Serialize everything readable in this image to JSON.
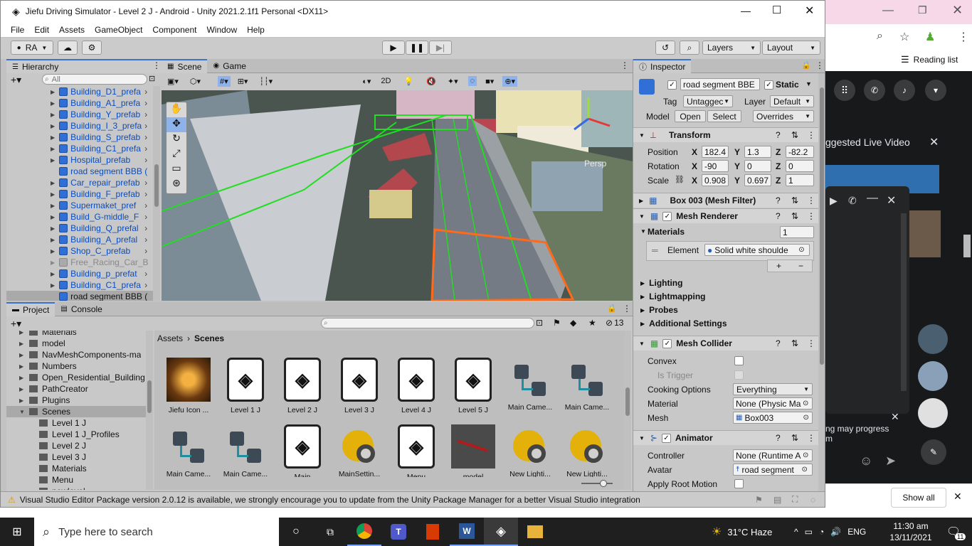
{
  "window": {
    "title": "Jiefu Driving Simulator - Level 2 J - Android - Unity 2021.2.1f1 Personal <DX11>"
  },
  "menu": [
    "File",
    "Edit",
    "Assets",
    "GameObject",
    "Component",
    "Window",
    "Help"
  ],
  "toolbar": {
    "account": "RA",
    "layers_label": "Layers",
    "layout_label": "Layout"
  },
  "hierarchy": {
    "tab": "Hierarchy",
    "search_placeholder": "All",
    "items": [
      {
        "label": "Building_D1_prefa"
      },
      {
        "label": "Building_A1_prefa"
      },
      {
        "label": "Building_Y_prefab"
      },
      {
        "label": "Building_I_3_prefa"
      },
      {
        "label": "Building_S_prefab"
      },
      {
        "label": "Building_C1_prefa"
      },
      {
        "label": "Hospital_prefab"
      },
      {
        "label": "road segment BBB ("
      },
      {
        "label": "Car_repair_prefab"
      },
      {
        "label": "Building_F_prefab"
      },
      {
        "label": "Supermaket_pref"
      },
      {
        "label": "Build_G-middle_F"
      },
      {
        "label": "Building_Q_prefal"
      },
      {
        "label": "Building_A_prefal"
      },
      {
        "label": "Shop_C_prefab"
      },
      {
        "label": "Free_Racing_Car_Bl"
      },
      {
        "label": "Building_p_prefat"
      },
      {
        "label": "Building_C1_prefa"
      },
      {
        "label": "road segment BBB ("
      }
    ]
  },
  "scene": {
    "tab_scene": "Scene",
    "tab_game": "Game",
    "mode_2d": "2D",
    "persp_label": "Persp"
  },
  "project": {
    "tab_project": "Project",
    "tab_console": "Console",
    "hidden_count": "13",
    "breadcrumb": [
      "Assets",
      "Scenes"
    ],
    "tree": [
      {
        "label": "Materials",
        "indent": 0
      },
      {
        "label": "model",
        "indent": 0
      },
      {
        "label": "NavMeshComponents-ma",
        "indent": 0
      },
      {
        "label": "Numbers",
        "indent": 0
      },
      {
        "label": "Open_Residential_Building",
        "indent": 0
      },
      {
        "label": "PathCreator",
        "indent": 0
      },
      {
        "label": "Plugins",
        "indent": 0
      },
      {
        "label": "Scenes",
        "indent": 0
      },
      {
        "label": "Level 1 J",
        "indent": 1
      },
      {
        "label": "Level 1 J_Profiles",
        "indent": 1
      },
      {
        "label": "Level 2 J",
        "indent": 1
      },
      {
        "label": "Level 3 J",
        "indent": 1
      },
      {
        "label": "Materials",
        "indent": 1
      },
      {
        "label": "Menu",
        "indent": 1
      },
      {
        "label": "newlevel",
        "indent": 1
      }
    ],
    "assets_row1": [
      {
        "label": "Jiefu Icon ...",
        "kind": "image"
      },
      {
        "label": "Level 1 J",
        "kind": "unity"
      },
      {
        "label": "Level 2 J",
        "kind": "unity"
      },
      {
        "label": "Level 3 J",
        "kind": "unity"
      },
      {
        "label": "Level 4 J",
        "kind": "unity"
      },
      {
        "label": "Level 5 J",
        "kind": "unity"
      },
      {
        "label": "Main Came...",
        "kind": "prefab"
      },
      {
        "label": "Main Came...",
        "kind": "prefab"
      }
    ],
    "assets_row2": [
      {
        "label": "Main Came...",
        "kind": "prefab"
      },
      {
        "label": "Main Came...",
        "kind": "prefab"
      },
      {
        "label": "Main",
        "kind": "unity"
      },
      {
        "label": "MainSettin...",
        "kind": "light"
      },
      {
        "label": "Menu",
        "kind": "unity"
      },
      {
        "label": "model",
        "kind": "model"
      },
      {
        "label": "New Lighti...",
        "kind": "light"
      },
      {
        "label": "New Lighti...",
        "kind": "light"
      }
    ]
  },
  "inspector": {
    "tab": "Inspector",
    "object_name": "road segment BBE",
    "static_label": "Static",
    "tag_label": "Tag",
    "tag_value": "Untaggec",
    "layer_label": "Layer",
    "layer_value": "Default",
    "model_label": "Model",
    "open_label": "Open",
    "select_label": "Select",
    "overrides_label": "Overrides",
    "transform": {
      "title": "Transform",
      "position_label": "Position",
      "rotation_label": "Rotation",
      "scale_label": "Scale",
      "position": {
        "x": "182.4",
        "y": "1.3",
        "z": "-82.2"
      },
      "rotation": {
        "x": "-90",
        "y": "0",
        "z": "0"
      },
      "scale": {
        "x": "0.908",
        "y": "0.697",
        "z": "1"
      }
    },
    "mesh_filter": "Box 003 (Mesh Filter)",
    "mesh_renderer": "Mesh Renderer",
    "materials_label": "Materials",
    "materials_count": "1",
    "element_label": "Element",
    "element_value": "Solid white shoulde",
    "foldouts": [
      "Lighting",
      "Lightmapping",
      "Probes",
      "Additional Settings"
    ],
    "mesh_collider": {
      "title": "Mesh Collider",
      "convex": "Convex",
      "is_trigger": "Is Trigger",
      "cooking_label": "Cooking Options",
      "cooking_value": "Everything",
      "material_label": "Material",
      "material_value": "None (Physic Ma",
      "mesh_label": "Mesh",
      "mesh_value": "Box003"
    },
    "animator": {
      "title": "Animator",
      "controller_label": "Controller",
      "controller_value": "None (Runtime A",
      "avatar_label": "Avatar",
      "avatar_value": "road segment",
      "apply_root_label": "Apply Root Motion"
    }
  },
  "statusbar": "Visual Studio Editor Package version 2.0.12 is available, we strongly encourage you to update from the Unity Package Manager for a better Visual Studio integration",
  "browser": {
    "reading_list": "Reading list",
    "suggested": "ggested Live Video",
    "progress_text": "ng may progress",
    "progress_text2": "m",
    "show_all": "Show all"
  },
  "taskbar": {
    "search_placeholder": "Type here to search",
    "weather": "31°C  Haze",
    "lang": "ENG",
    "time": "11:30 am",
    "date": "13/11/2021",
    "notif_count": "11"
  }
}
